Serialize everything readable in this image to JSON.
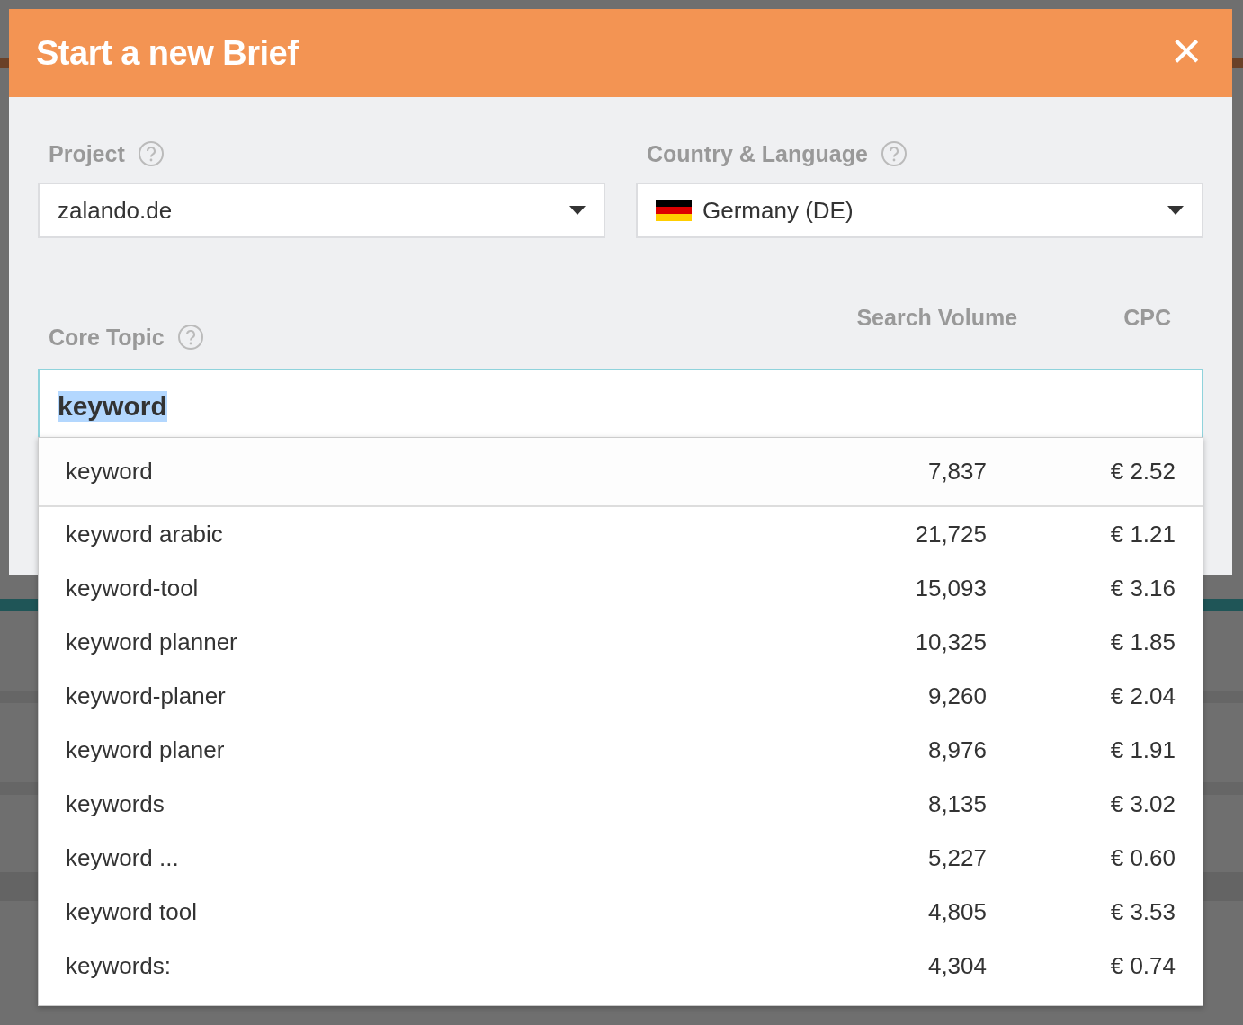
{
  "dialog": {
    "title": "Start a new Brief",
    "close": "×"
  },
  "project": {
    "label": "Project",
    "value": "zalando.de"
  },
  "country": {
    "label": "Country & Language",
    "value": "Germany (DE)"
  },
  "core_topic": {
    "label": "Core Topic",
    "value": "keyword",
    "text_highlighted": true
  },
  "columns": {
    "volume": "Search Volume",
    "cpc": "CPC"
  },
  "suggestions": [
    {
      "keyword": "keyword",
      "volume": "7,837",
      "cpc": "€ 2.52",
      "selected": true
    },
    {
      "keyword": "keyword arabic",
      "volume": "21,725",
      "cpc": "€ 1.21",
      "selected": false
    },
    {
      "keyword": "keyword-tool",
      "volume": "15,093",
      "cpc": "€ 3.16",
      "selected": false
    },
    {
      "keyword": "keyword planner",
      "volume": "10,325",
      "cpc": "€ 1.85",
      "selected": false
    },
    {
      "keyword": "keyword-planer",
      "volume": "9,260",
      "cpc": "€ 2.04",
      "selected": false
    },
    {
      "keyword": "keyword planer",
      "volume": "8,976",
      "cpc": "€ 1.91",
      "selected": false
    },
    {
      "keyword": "keywords",
      "volume": "8,135",
      "cpc": "€ 3.02",
      "selected": false
    },
    {
      "keyword": "keyword ...",
      "volume": "5,227",
      "cpc": "€ 0.60",
      "selected": false
    },
    {
      "keyword": "keyword tool",
      "volume": "4,805",
      "cpc": "€ 3.53",
      "selected": false
    },
    {
      "keyword": "keywords:",
      "volume": "4,304",
      "cpc": "€ 0.74",
      "selected": false
    }
  ]
}
